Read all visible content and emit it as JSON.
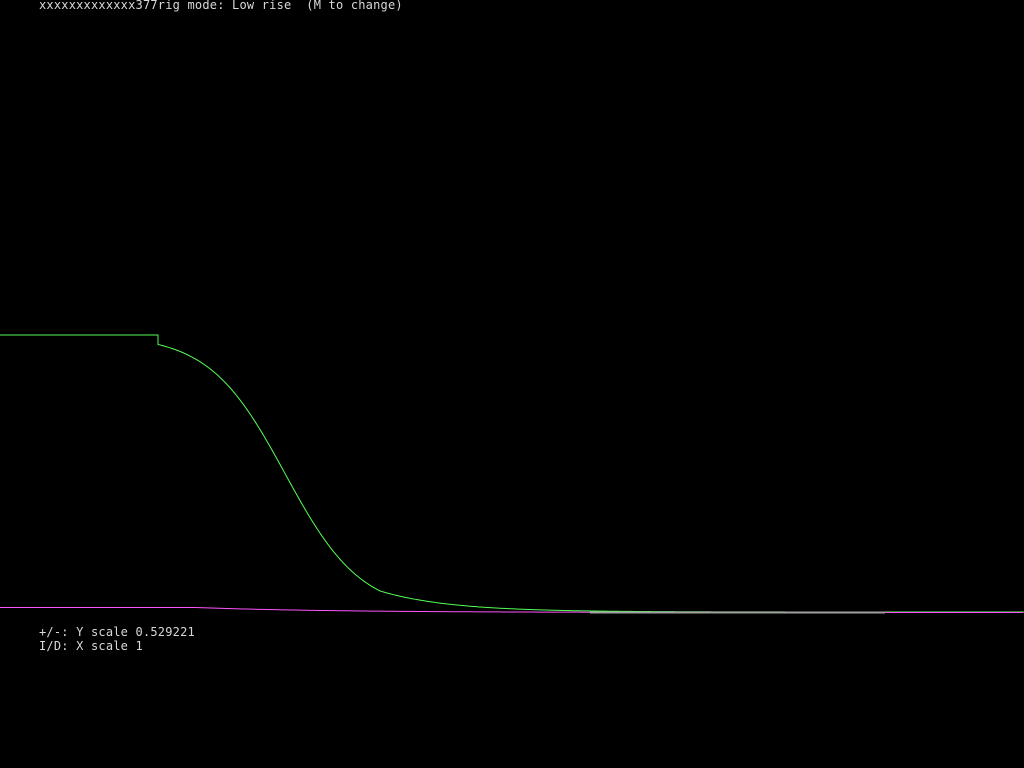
{
  "status_line": "xxxxxxxxxxxxx377rig mode: Low rise  (M to change)",
  "hints": {
    "y_scale": "+/-: Y scale 0.529221",
    "x_scale": "I/D: X scale 1"
  },
  "values": {
    "y_scale": 0.529221,
    "x_scale": 1
  },
  "colors": {
    "background": "#000000",
    "text": "#d8d8d8",
    "curve_primary": "#55ff55",
    "curve_secondary": "#ff55ff",
    "baseline": "#a0a0a0"
  }
}
